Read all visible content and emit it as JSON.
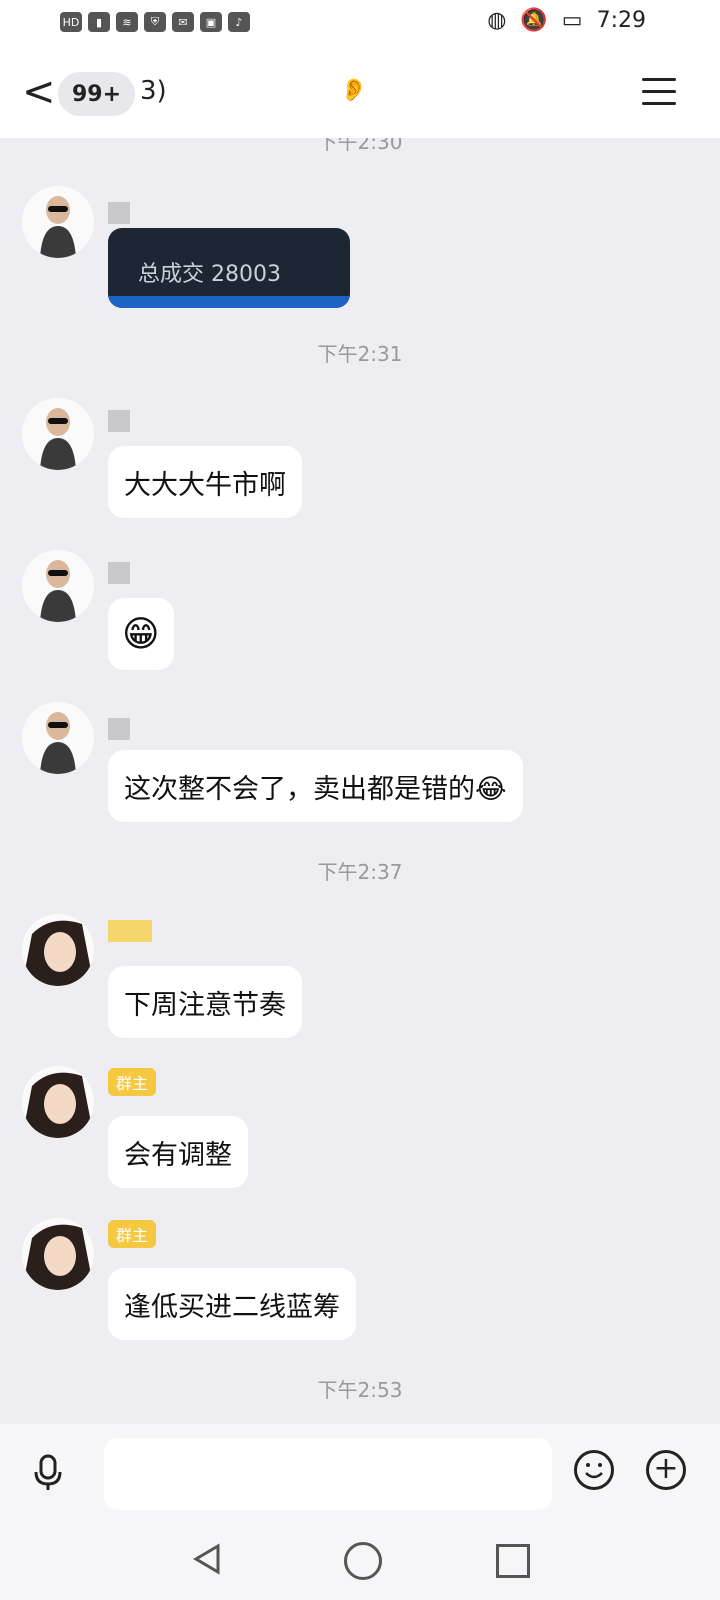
{
  "status_bar": {
    "left_icons": [
      "HD",
      "5G",
      "signal-icon",
      "wifi-icon",
      "location-icon",
      "shield-icon",
      "wechat-icon",
      "app-icon",
      "tiktok-icon"
    ],
    "time": "7:29"
  },
  "header": {
    "back_label": "<",
    "badge": "99+",
    "title": "3)"
  },
  "messages": [
    {
      "timestamp": "下午2:30"
    },
    {
      "type": "image",
      "text": "总成交 28003"
    },
    {
      "timestamp": "下午2:31"
    },
    {
      "type": "text",
      "text": "大大大牛市啊"
    },
    {
      "type": "emoji",
      "text": "😁"
    },
    {
      "type": "text",
      "text": "这次整不会了，卖出都是错的😂"
    },
    {
      "timestamp": "下午2:37"
    },
    {
      "type": "text",
      "text": "下周注意节奏"
    },
    {
      "type": "text",
      "text": "会有调整",
      "tag": "群主"
    },
    {
      "type": "text",
      "text": "逢低买进二线蓝筹",
      "tag": "群主"
    },
    {
      "timestamp": "下午2:53"
    }
  ],
  "input": {
    "placeholder": ""
  }
}
